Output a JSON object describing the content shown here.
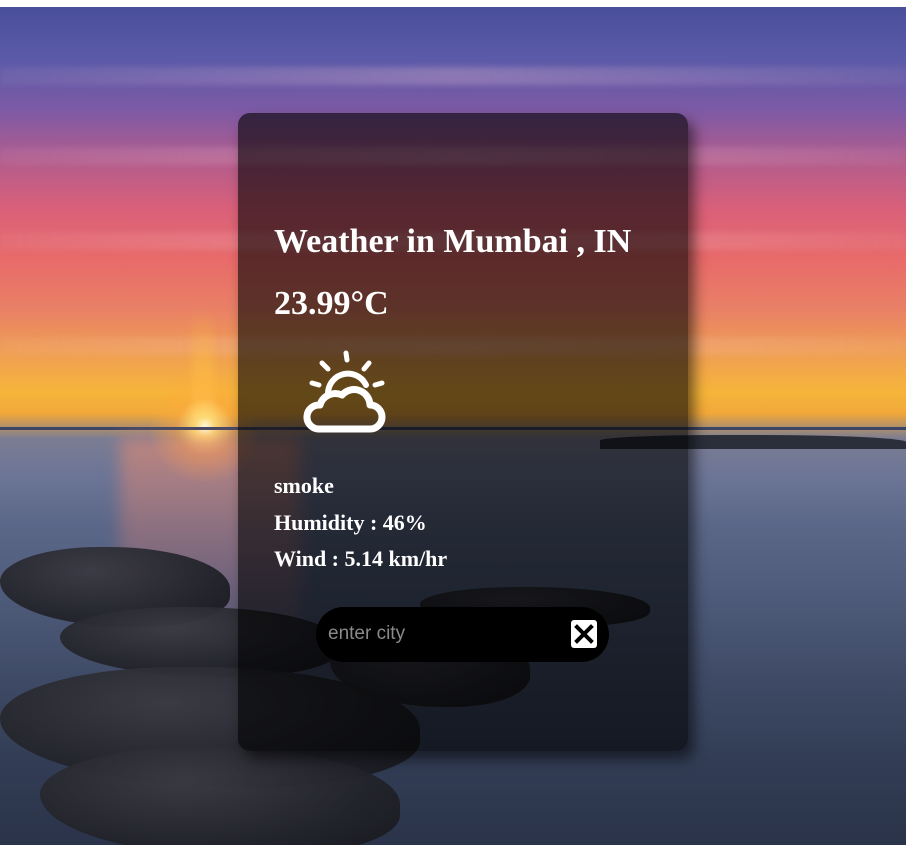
{
  "weather": {
    "title": "Weather in Mumbai , IN",
    "temperature": "23.99°C",
    "icon": "partly-cloudy-icon",
    "description": "smoke",
    "humidity": "Humidity : 46%",
    "wind": "Wind : 5.14 km/hr"
  },
  "search": {
    "placeholder": "enter city",
    "value": "",
    "button_icon": "close-x-icon"
  },
  "colors": {
    "card_background": "rgba(0,0,0,0.6)",
    "text": "#ffffff",
    "search_background": "#000000",
    "placeholder": "#8a8a8a"
  }
}
